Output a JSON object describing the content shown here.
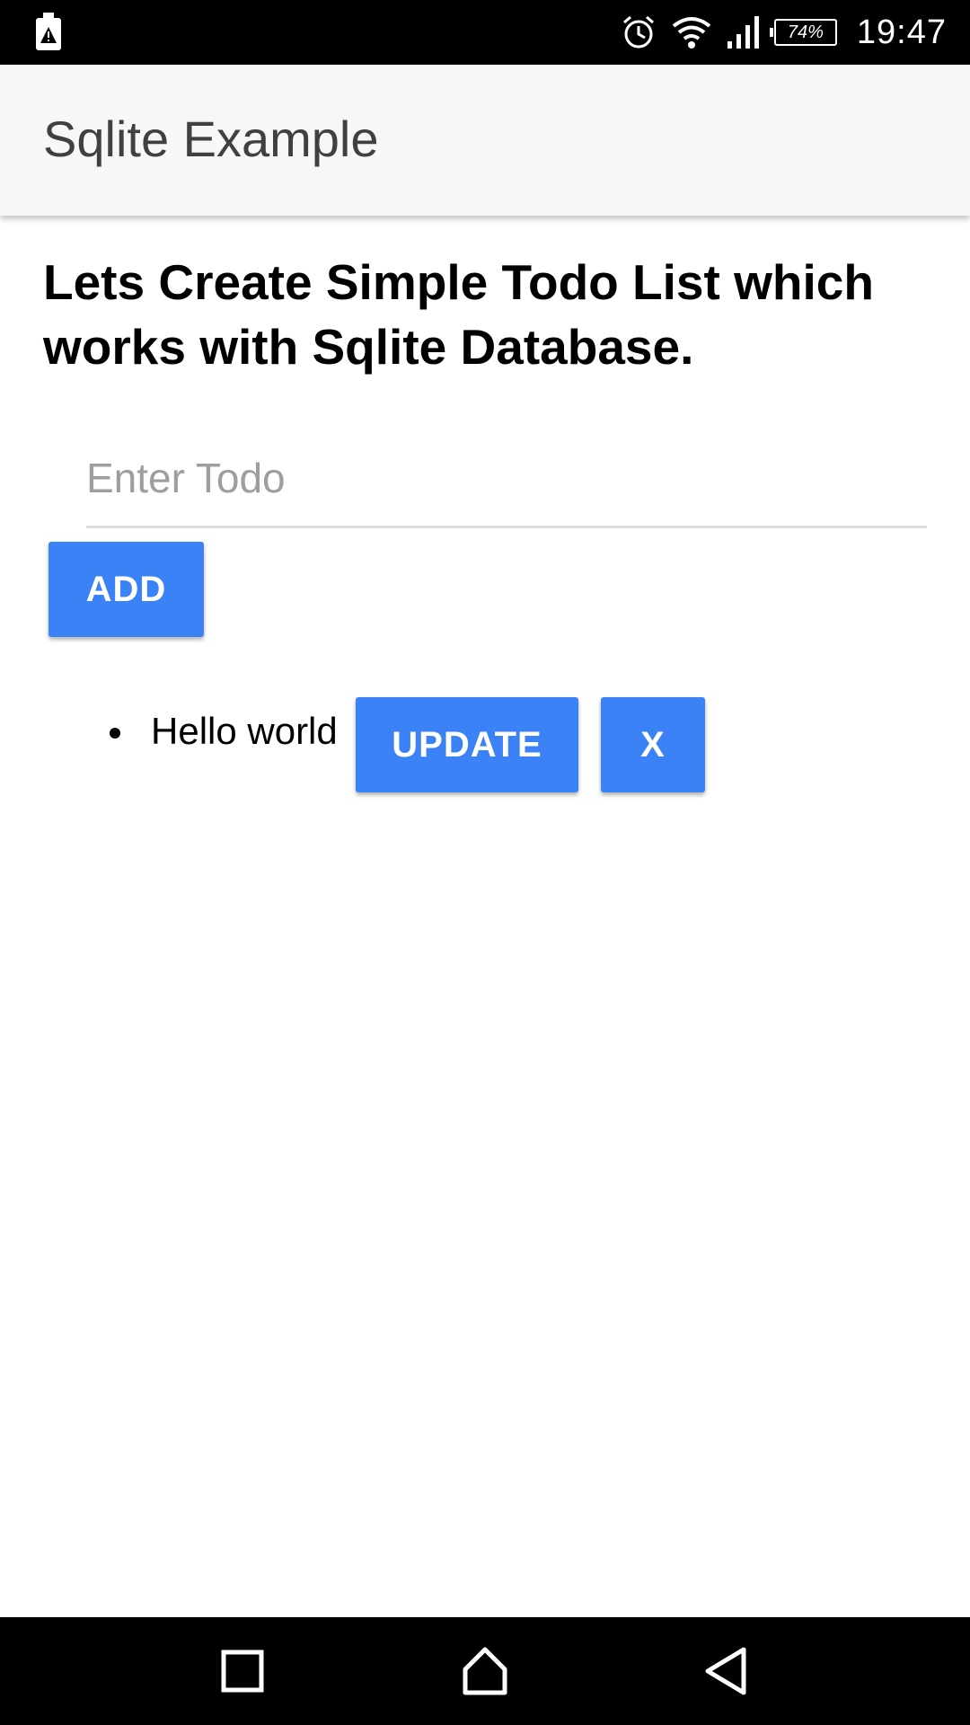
{
  "status_bar": {
    "battery_percent": "74%",
    "time": "19:47",
    "icons": [
      "sim-alert-icon",
      "alarm-icon",
      "wifi-icon",
      "signal-icon",
      "battery-icon"
    ]
  },
  "app_bar": {
    "title": "Sqlite Example"
  },
  "content": {
    "heading": "Lets Create Simple Todo List which works with Sqlite Database.",
    "todo_input": {
      "placeholder": "Enter Todo",
      "value": ""
    },
    "add_label": "ADD",
    "todos": [
      {
        "text": "Hello world",
        "update_label": "UPDATE",
        "delete_label": "X"
      }
    ]
  },
  "nav_bar": {
    "icons": [
      "recents-icon",
      "home-icon",
      "back-icon"
    ]
  },
  "colors": {
    "accent": "#3b82f6",
    "app_bar_bg": "#f7f7f7",
    "title_text": "#404040"
  }
}
